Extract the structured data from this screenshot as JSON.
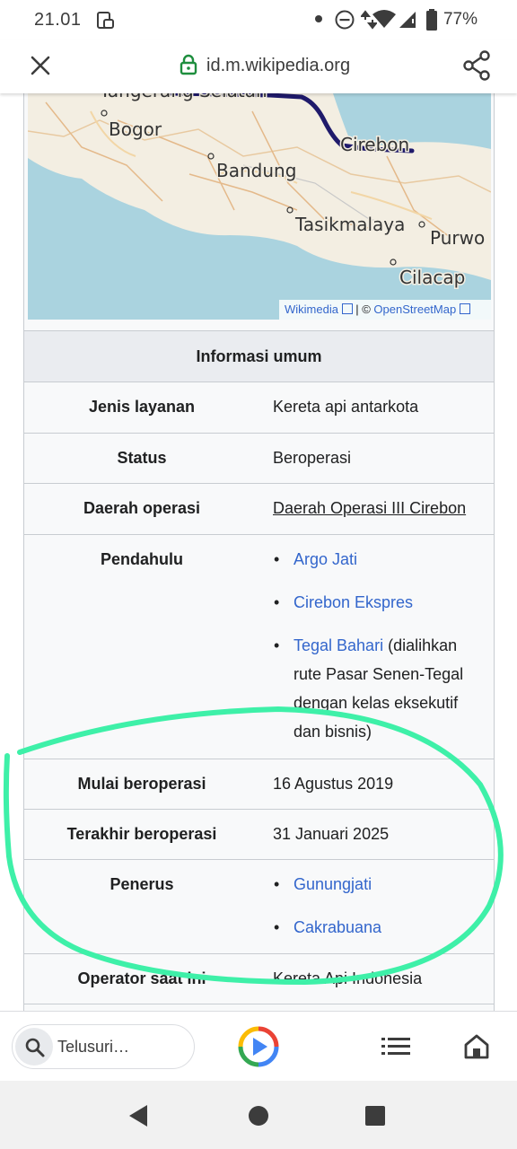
{
  "status_bar": {
    "time": "21.01",
    "battery": "77%"
  },
  "url_bar": {
    "url": "id.m.wikipedia.org"
  },
  "map": {
    "places": [
      "Tangerang Selatan",
      "Bogor",
      "Bandung",
      "Cirebon",
      "Tasikmalaya",
      "Purwo",
      "Cilacap"
    ],
    "attribution_wikimedia": "Wikimedia",
    "attribution_sep": "| ©",
    "attribution_osm": "OpenStreetMap"
  },
  "infobox": {
    "header": "Informasi umum",
    "rows": {
      "jenis": {
        "label": "Jenis layanan",
        "value": "Kereta api antarkota"
      },
      "status": {
        "label": "Status",
        "value": "Beroperasi"
      },
      "daerah": {
        "label": "Daerah operasi",
        "value": "Daerah Operasi III Cirebon"
      },
      "pendahulu": {
        "label": "Pendahulu",
        "items": [
          {
            "link": "Argo Jati"
          },
          {
            "link": "Cirebon Ekspres"
          },
          {
            "link": "Tegal Bahari",
            "rest_line1": " (dialihkan",
            "rest_lines": [
              "rute Pasar Senen-Tegal",
              "dengan kelas eksekutif",
              "dan bisnis)"
            ]
          }
        ]
      },
      "mulai": {
        "label": "Mulai beroperasi",
        "value": "16 Agustus 2019"
      },
      "terakhir": {
        "label": "Terakhir beroperasi",
        "value": "31 Januari 2025"
      },
      "penerus": {
        "label": "Penerus",
        "items": [
          "Gunungjati",
          "Cakrabuana"
        ]
      },
      "operator": {
        "label": "Operator saat ini",
        "value": "Kereta Api Indonesia"
      }
    }
  },
  "toolbar": {
    "search_placeholder": "Telusuri…"
  },
  "colors": {
    "highlight_stroke": "#3ef0a8",
    "link": "#3366cc",
    "route": "#1f1a6b"
  }
}
